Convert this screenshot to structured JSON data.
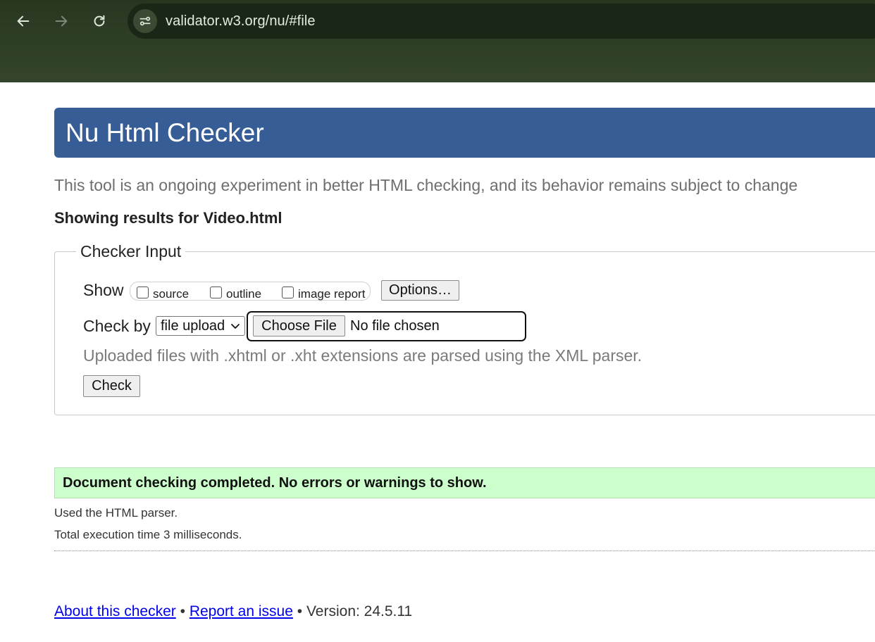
{
  "browser": {
    "url": "validator.w3.org/nu/#file",
    "icons": {
      "back": "arrow-left-icon",
      "forward": "arrow-right-icon",
      "reload": "reload-icon",
      "site_info": "tune-icon"
    }
  },
  "page": {
    "title": "Nu Html Checker",
    "intro": "This tool is an ongoing experiment in better HTML checking, and its behavior remains subject to change",
    "results_heading": "Showing results for Video.html",
    "colors": {
      "banner": "#365d95",
      "success_bg": "#ccffcc",
      "link": "#0000ee"
    }
  },
  "checker_input": {
    "legend": "Checker Input",
    "show_label": "Show",
    "show_options": [
      {
        "label": "source",
        "checked": false
      },
      {
        "label": "outline",
        "checked": false
      },
      {
        "label": "image report",
        "checked": false
      }
    ],
    "options_button": "Options…",
    "check_by_label": "Check by",
    "check_by_value": "file upload",
    "choose_file_button": "Choose File",
    "file_status": "No file chosen",
    "xml_note": "Uploaded files with .xhtml or .xht extensions are parsed using the XML parser.",
    "check_button": "Check"
  },
  "results": {
    "success_message": "Document checking completed. No errors or warnings to show.",
    "parser_note": "Used the HTML parser.",
    "time_note": "Total execution time 3 milliseconds."
  },
  "footer": {
    "about_link": "About this checker",
    "separator": "•",
    "report_link": "Report an issue",
    "version": "Version: 24.5.11"
  }
}
